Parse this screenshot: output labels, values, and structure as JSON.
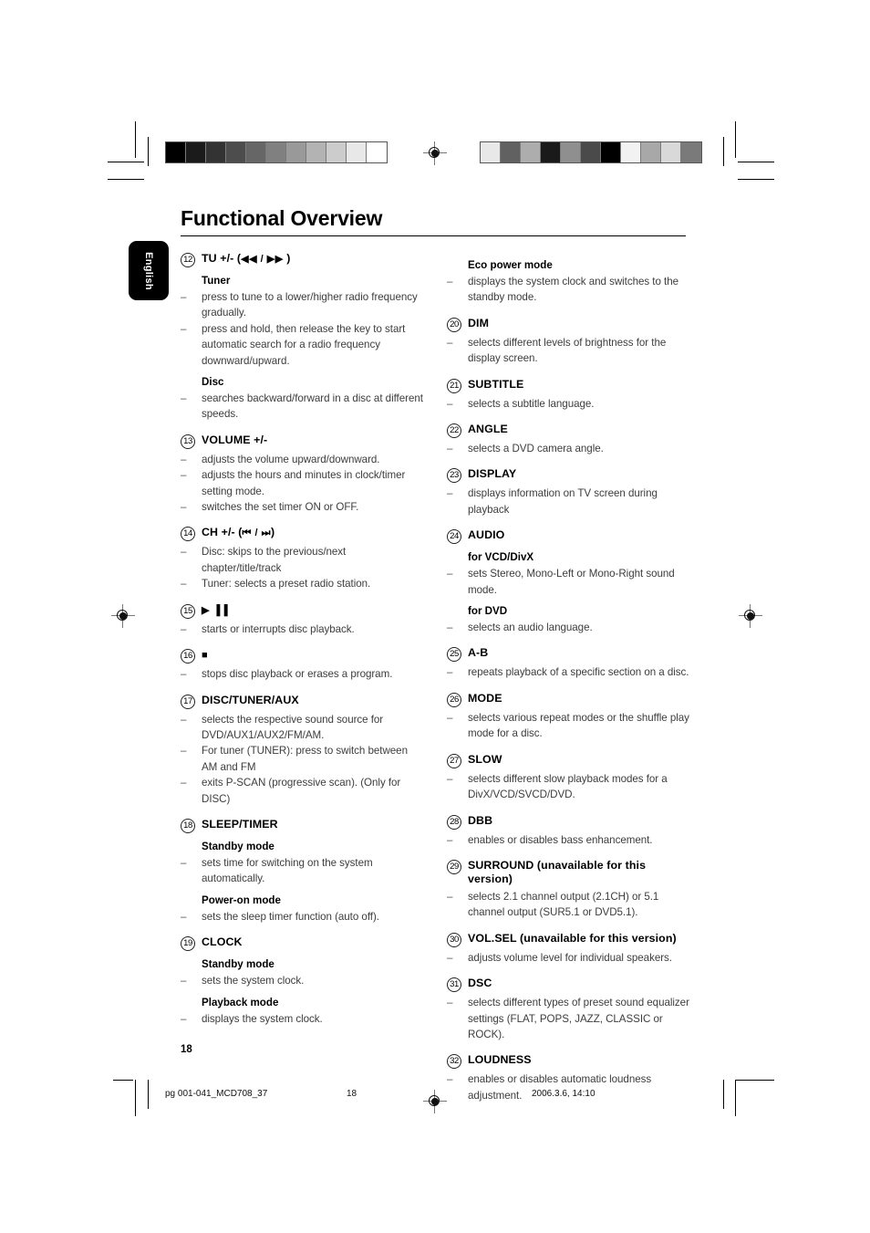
{
  "header": {
    "title": "Functional Overview",
    "language_tab": "English"
  },
  "page_number": "18",
  "footer": {
    "file": "pg 001-041_MCD708_37",
    "page": "18",
    "date": "2006.3.6, 14:10"
  },
  "colorbars": {
    "left": [
      "#000000",
      "#1b1b1b",
      "#333333",
      "#4d4d4d",
      "#666666",
      "#808080",
      "#999999",
      "#b3b3b3",
      "#cccccc",
      "#e8e8e8",
      "#ffffff"
    ],
    "right": [
      "#e8e8e8",
      "#616161",
      "#adadad",
      "#1a1a1a",
      "#8f8f8f",
      "#4a4a4a",
      "#000000",
      "#f2f2f2",
      "#a8a8a8",
      "#d9d9d9",
      "#7a7a7a"
    ]
  },
  "left_column": [
    {
      "num": "12",
      "label": "TU +/- (",
      "glyph": "◀◀ / ▶▶",
      "label_end": " )",
      "blocks": [
        {
          "submode": "Tuner"
        },
        {
          "bullet": "press to tune to a lower/higher radio frequency gradually."
        },
        {
          "bullet": "press and hold, then release the key to start automatic search for a radio frequency downward/upward."
        },
        {
          "submode": "Disc"
        },
        {
          "bullet": "searches backward/forward in a disc at different speeds."
        }
      ]
    },
    {
      "num": "13",
      "label": "VOLUME +/-",
      "blocks": [
        {
          "bullet": "adjusts the volume upward/downward."
        },
        {
          "bullet": "adjusts the hours and minutes in clock/timer setting mode."
        },
        {
          "bullet": "switches the set timer ON or OFF."
        }
      ]
    },
    {
      "num": "14",
      "label": "CH +/- (",
      "glyph": "⏮ / ⏭",
      "label_end": ")",
      "blocks": [
        {
          "bullet": "Disc: skips to the previous/next chapter/title/track"
        },
        {
          "bullet": "Tuner: selects a preset radio station."
        }
      ]
    },
    {
      "num": "15",
      "label": "",
      "glyph": "▶ ▐▐",
      "label_end": "",
      "blocks": [
        {
          "bullet": "starts or interrupts disc playback."
        }
      ]
    },
    {
      "num": "16",
      "label": "",
      "glyph": "■",
      "label_end": "",
      "blocks": [
        {
          "bullet": "stops disc playback or erases a program."
        }
      ]
    },
    {
      "num": "17",
      "label": "DISC/TUNER/AUX",
      "blocks": [
        {
          "bullet": "selects the respective sound source for DVD/AUX1/AUX2/FM/AM."
        },
        {
          "bullet": "For tuner (TUNER): press to switch between AM and FM"
        },
        {
          "bullet": "exits P-SCAN (progressive scan). (Only for DISC)"
        }
      ]
    },
    {
      "num": "18",
      "label": "SLEEP/TIMER",
      "blocks": [
        {
          "submode": "Standby mode"
        },
        {
          "bullet": "sets time for switching on the system automatically."
        },
        {
          "submode": "Power-on mode"
        },
        {
          "bullet": "sets the sleep timer function (auto off)."
        }
      ]
    },
    {
      "num": "19",
      "label": "CLOCK",
      "blocks": [
        {
          "submode": "Standby mode"
        },
        {
          "bullet": "sets the system clock."
        },
        {
          "submode": "Playback mode"
        },
        {
          "bullet": "displays the system clock."
        }
      ]
    }
  ],
  "right_column": [
    {
      "num": "",
      "label": "",
      "blocks": [
        {
          "submode": "Eco power mode"
        },
        {
          "bullet": "displays the system clock and switches to the standby mode."
        }
      ]
    },
    {
      "num": "20",
      "label": "DIM",
      "blocks": [
        {
          "bullet": "selects different levels of brightness for the display screen."
        }
      ]
    },
    {
      "num": "21",
      "label": "SUBTITLE",
      "blocks": [
        {
          "bullet": "selects a subtitle language."
        }
      ]
    },
    {
      "num": "22",
      "label": "ANGLE",
      "blocks": [
        {
          "bullet": "selects a DVD camera angle."
        }
      ]
    },
    {
      "num": "23",
      "label": "DISPLAY",
      "blocks": [
        {
          "bullet": "displays information on TV screen during playback"
        }
      ]
    },
    {
      "num": "24",
      "label": "AUDIO",
      "blocks": [
        {
          "submode": "for VCD/DivX"
        },
        {
          "bullet": "sets Stereo, Mono-Left or Mono-Right sound mode."
        },
        {
          "submode": "for DVD"
        },
        {
          "bullet": "selects an audio language."
        }
      ]
    },
    {
      "num": "25",
      "label": "A-B",
      "blocks": [
        {
          "bullet": "repeats playback of a specific section on a disc."
        }
      ]
    },
    {
      "num": "26",
      "label": "MODE",
      "blocks": [
        {
          "bullet": "selects various repeat modes or the shuffle play mode for a disc."
        }
      ]
    },
    {
      "num": "27",
      "label": "SLOW",
      "blocks": [
        {
          "bullet": "selects different slow playback modes for a DivX/VCD/SVCD/DVD."
        }
      ]
    },
    {
      "num": "28",
      "label": "DBB",
      "blocks": [
        {
          "bullet": "enables or disables bass enhancement."
        }
      ]
    },
    {
      "num": "29",
      "label": "SURROUND (unavailable for this version)",
      "blocks": [
        {
          "bullet": "selects 2.1 channel output (2.1CH) or 5.1 channel output (SUR5.1 or DVD5.1)."
        }
      ]
    },
    {
      "num": "30",
      "label": "VOL.SEL (unavailable for this version)",
      "blocks": [
        {
          "bullet": "adjusts volume level for individual speakers."
        }
      ]
    },
    {
      "num": "31",
      "label": "DSC",
      "blocks": [
        {
          "bullet": "selects different types of preset sound equalizer settings (FLAT, POPS, JAZZ, CLASSIC or ROCK)."
        }
      ]
    },
    {
      "num": "32",
      "label": "LOUDNESS",
      "blocks": [
        {
          "bullet": "enables or disables automatic loudness adjustment."
        }
      ]
    }
  ]
}
